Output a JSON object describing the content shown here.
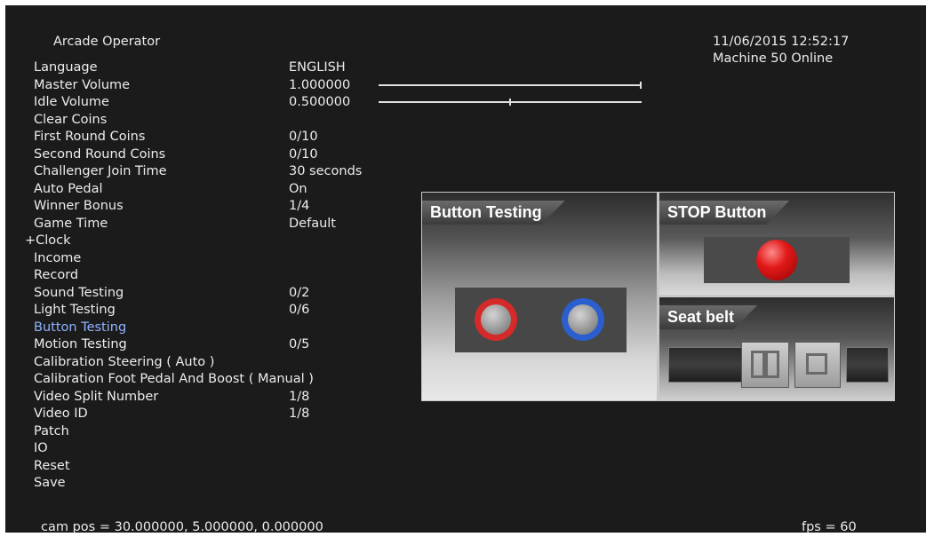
{
  "header": {
    "title": "Arcade Operator",
    "datetime": "11/06/2015 12:52:17",
    "machine_status": "Machine 50  Online"
  },
  "menu": [
    {
      "label": "Language",
      "value": "ENGLISH"
    },
    {
      "label": "Master Volume",
      "value": "1.000000",
      "slider_fraction": 1.0
    },
    {
      "label": "Idle Volume",
      "value": "0.500000",
      "slider_fraction": 0.5
    },
    {
      "label": "Clear Coins",
      "value": ""
    },
    {
      "label": "First Round Coins",
      "value": "0/10"
    },
    {
      "label": "Second Round Coins",
      "value": "0/10"
    },
    {
      "label": "Challenger Join Time",
      "value": "30 seconds"
    },
    {
      "label": "Auto Pedal",
      "value": "On"
    },
    {
      "label": "Winner Bonus",
      "value": "1/4"
    },
    {
      "label": "Game Time",
      "value": "Default"
    },
    {
      "label": "+Clock",
      "value": ""
    },
    {
      "label": "Income",
      "value": ""
    },
    {
      "label": "Record",
      "value": ""
    },
    {
      "label": "Sound Testing",
      "value": "0/2"
    },
    {
      "label": "Light Testing",
      "value": "0/6"
    },
    {
      "label": "Button Testing",
      "value": "",
      "selected": true
    },
    {
      "label": "Motion Testing",
      "value": "0/5"
    },
    {
      "label": "Calibration Steering ( Auto )",
      "value": ""
    },
    {
      "label": "Calibration Foot Pedal And Boost ( Manual )",
      "value": ""
    },
    {
      "label": "Video Split Number",
      "value": "1/8"
    },
    {
      "label": "Video ID",
      "value": "1/8"
    },
    {
      "label": "Patch",
      "value": ""
    },
    {
      "label": "IO",
      "value": ""
    },
    {
      "label": "Reset",
      "value": ""
    },
    {
      "label": "Save",
      "value": ""
    }
  ],
  "panels": {
    "button_testing": {
      "title": "Button Testing",
      "icons": [
        "red-ring-button-icon",
        "blue-ring-button-icon"
      ]
    },
    "stop_button": {
      "title": "STOP Button",
      "icon": "red-stop-button-icon"
    },
    "seat_belt": {
      "title": "Seat belt",
      "icon": "seat-belt-buckle-icon"
    }
  },
  "footer": {
    "cam_pos": "cam pos = 30.000000, 5.000000, 0.000000",
    "fps": "fps = 60"
  },
  "colors": {
    "background": "#1b1b1b",
    "text": "#ececec",
    "selected_item": "#8fb3ff",
    "red_ring": "#d42a2a",
    "blue_ring": "#2b5fcf",
    "stop_button": "#e11a1a"
  }
}
